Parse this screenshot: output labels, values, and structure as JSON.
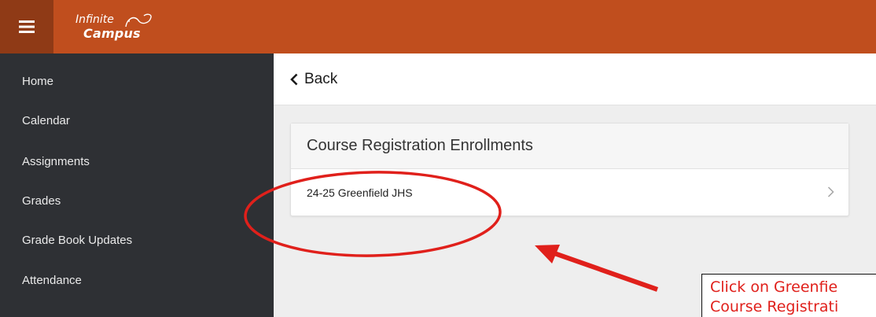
{
  "header": {
    "menu_icon": "hamburger-menu-icon",
    "logo": {
      "line1": "Infinite",
      "line2": "Campus"
    },
    "colors": {
      "primary": "#c04e1e",
      "menu_button": "#8f3a16"
    }
  },
  "sidebar": {
    "background": "#2e3034",
    "items": [
      {
        "label": "Home"
      },
      {
        "label": "Calendar"
      },
      {
        "label": "Assignments"
      },
      {
        "label": "Grades"
      },
      {
        "label": "Grade Book Updates"
      },
      {
        "label": "Attendance"
      }
    ]
  },
  "back": {
    "label": "Back",
    "icon": "chevron-left-icon"
  },
  "card": {
    "title": "Course Registration Enrollments",
    "rows": [
      {
        "label": "24-25 Greenfield JHS",
        "icon": "chevron-right-icon"
      }
    ]
  },
  "annotation": {
    "color": "#e0201b",
    "callout_lines": [
      "Click on Greenfie",
      "Course Registrati"
    ]
  }
}
